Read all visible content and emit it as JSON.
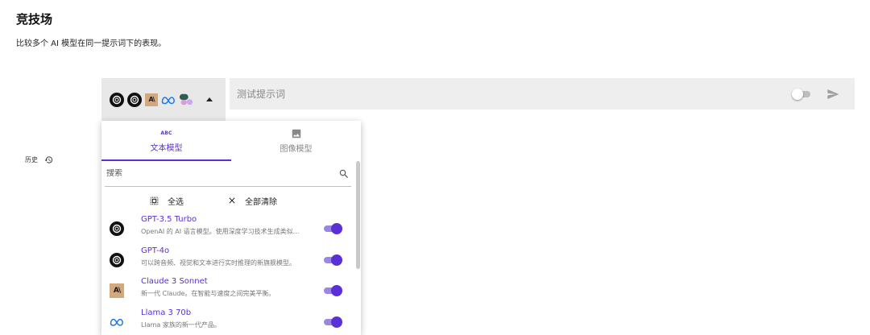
{
  "page": {
    "title": "竞技场",
    "subtitle": "比较多个 AI 模型在同一提示词下的表现。"
  },
  "history": {
    "label": "历史",
    "icon": "history-icon"
  },
  "model_picker": {
    "icons": [
      "openai-icon",
      "openai-icon",
      "anthropic-icon",
      "meta-icon",
      "image-model-icon"
    ],
    "anthropic_glyph": "A\\"
  },
  "prompt": {
    "placeholder": "测试提示词",
    "toggle_on": false,
    "send_icon": "send-icon"
  },
  "dropdown": {
    "tabs": [
      {
        "label": "文本模型",
        "icon_text": "ABC",
        "active": true
      },
      {
        "label": "图像模型",
        "icon": "image-icon",
        "active": false
      }
    ],
    "search": {
      "placeholder": "搜索"
    },
    "select_all_label": "全选",
    "clear_all_label": "全部清除",
    "models": [
      {
        "name": "GPT-3.5 Turbo",
        "description": "OpenAI 的 AI 语言模型。使用深度学习技术生成类似...",
        "logo": "openai-icon",
        "enabled": true
      },
      {
        "name": "GPT-4o",
        "description": "可以跨音频、视觉和文本进行实时推理的新旗舰模型。",
        "logo": "openai-icon",
        "enabled": true
      },
      {
        "name": "Claude 3 Sonnet",
        "description": "新一代 Claude。在智能与速度之间完美平衡。",
        "logo": "anthropic-icon",
        "enabled": true
      },
      {
        "name": "Llama 3 70b",
        "description": "Llama 家族的新一代产品。",
        "logo": "meta-icon",
        "enabled": true
      }
    ]
  },
  "colors": {
    "accent": "#5a2fd6",
    "toggle_track": "#9a86e6",
    "prompt_bg": "#eeeeee",
    "picker_bg": "#e8e8e8",
    "anthropic_bg": "#d4a87e"
  }
}
